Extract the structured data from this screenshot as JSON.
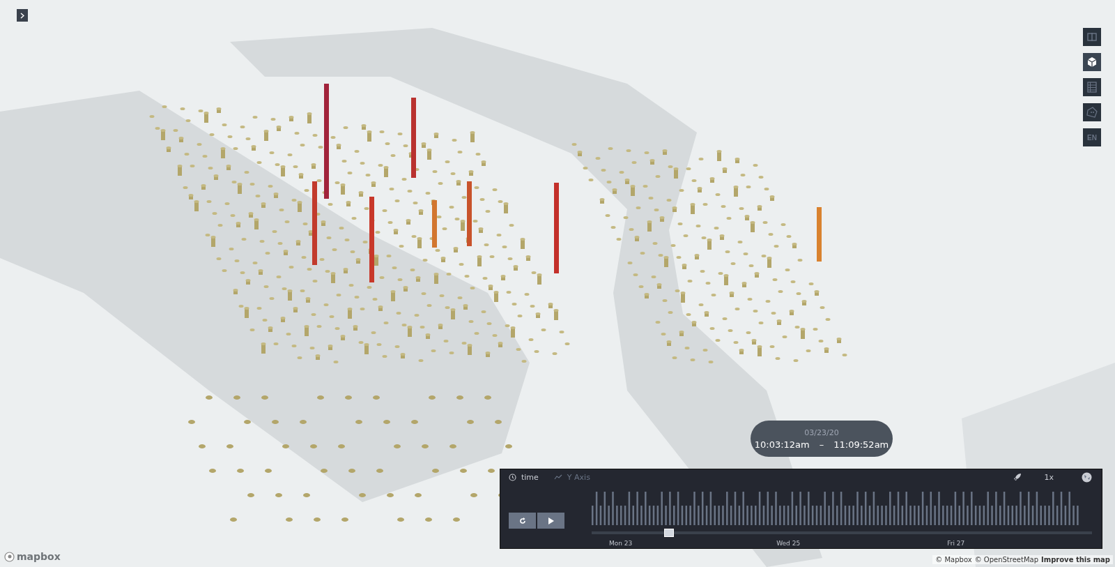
{
  "map_controls": [
    {
      "kind": "split",
      "selected": false
    },
    {
      "kind": "perspective",
      "selected": true
    },
    {
      "kind": "legend",
      "selected": false
    },
    {
      "kind": "draw",
      "selected": false
    },
    {
      "kind": "locale",
      "label": "EN",
      "selected": false
    }
  ],
  "time_popup": {
    "date": "03/23/20",
    "start": "10:03:12am",
    "separator": "–",
    "end": "11:09:52am"
  },
  "timeline": {
    "tabs": [
      {
        "label": "time",
        "kind": "clock",
        "selected": true
      },
      {
        "label": "Y Axis",
        "kind": "trend",
        "selected": false
      }
    ],
    "speed": "1x",
    "slider": {
      "level": 0.155
    },
    "ticks": [
      "Mon 23",
      "Wed 25",
      "Fri 27"
    ]
  },
  "attribution": {
    "logo": "mapbox",
    "links": [
      "© Mapbox",
      "© OpenStreetMap",
      "Improve this map"
    ]
  }
}
